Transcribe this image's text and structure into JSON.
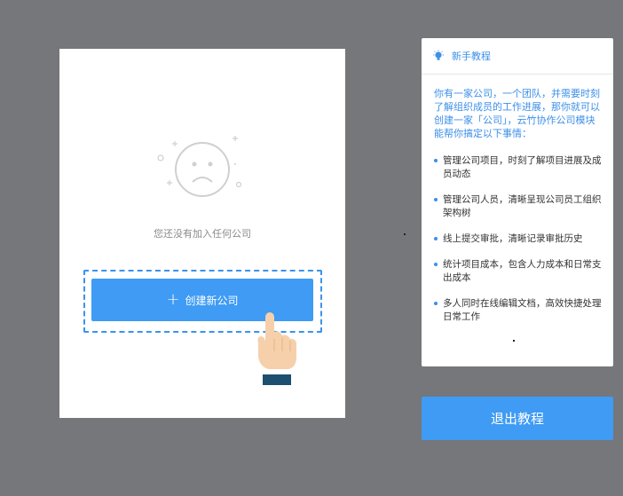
{
  "empty_state": {
    "message": "您还没有加入任何公司"
  },
  "actions": {
    "create_company_label": "创建新公司",
    "plus_symbol": "+"
  },
  "tutorial": {
    "title": "新手教程",
    "intro": "你有一家公司，一个团队，并需要时刻了解组织成员的工作进展，那你就可以创建一家「公司」，云竹协作公司模块能帮你搞定以下事情：",
    "items": [
      "管理公司项目，时刻了解项目进展及成员动态",
      "管理公司人员，清晰呈现公司员工组织架构树",
      "线上提交审批，清晰记录审批历史",
      "统计项目成本，包含人力成本和日常支出成本",
      "多人同时在线编辑文档，高效快捷处理日常工作"
    ],
    "exit_label": "退出教程"
  },
  "colors": {
    "accent": "#3f9bf4",
    "tutorial_text": "#3d8fe8",
    "overlay": "#76777a"
  },
  "icons": [
    "sad-face-icon",
    "plus-icon",
    "pointing-hand-icon",
    "lightbulb-icon"
  ]
}
